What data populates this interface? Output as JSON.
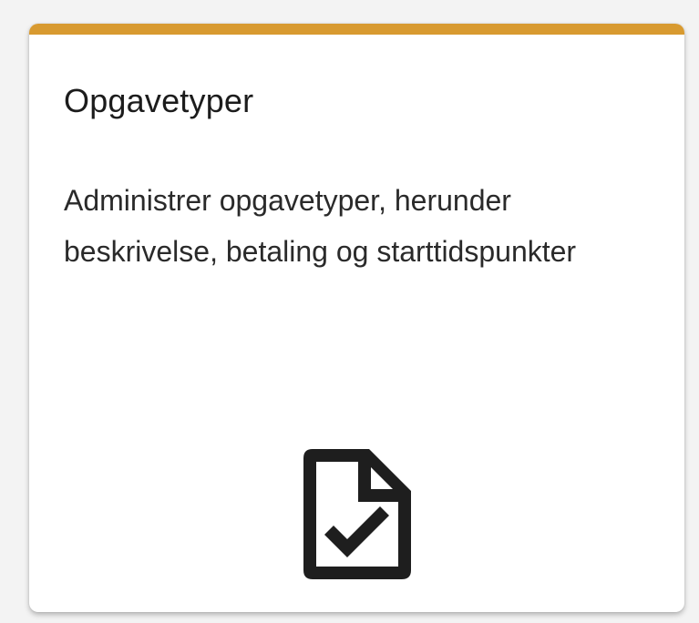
{
  "card": {
    "title": "Opgavetyper",
    "description": "Administrer opgavetyper, herunder beskrivelse, betaling og starttidspunkter",
    "icon": "file-check-icon",
    "accent_color": "#d89a30",
    "icon_color": "#1e1e1e"
  }
}
